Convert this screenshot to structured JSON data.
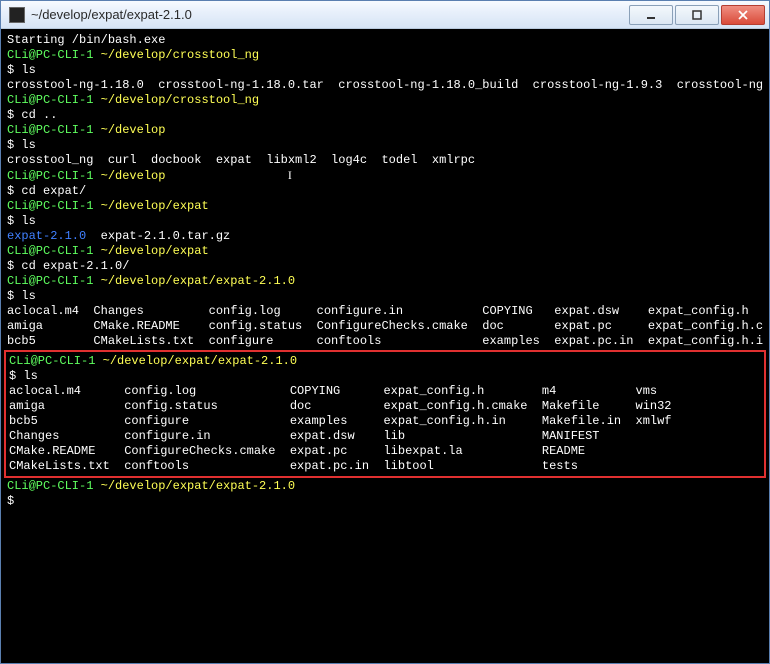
{
  "window": {
    "title": "~/develop/expat/expat-2.1.0"
  },
  "terminal": {
    "start": "Starting /bin/bash.exe",
    "user": "CLi",
    "host": "PC-CLI-1",
    "prompt": "$",
    "blocks": [
      {
        "path": "~/develop/crosstool_ng",
        "cmd": "ls",
        "out": "crosstool-ng-1.18.0  crosstool-ng-1.18.0.tar  crosstool-ng-1.18.0_build  crosstool-ng-1.9.3  crosstool-ng"
      },
      {
        "cmd": "cd .."
      },
      {
        "path": "~/develop",
        "cmd": "ls",
        "out": "crosstool_ng  curl  docbook  expat  libxml2  log4c  todel  xmlrpc"
      },
      {
        "path": "~/develop",
        "cmd": "cd expat/",
        "ibeam": true
      },
      {
        "path": "~/develop/expat",
        "cmd": "ls",
        "out_parts": [
          {
            "t": "expat-2.1.0",
            "c": "blue"
          },
          {
            "t": "  expat-2.1.0.tar.gz",
            "c": "white"
          }
        ]
      },
      {
        "path": "~/develop/expat",
        "cmd": "cd expat-2.1.0/"
      },
      {
        "path": "~/develop/expat/expat-2.1.0",
        "cmd": "ls",
        "out_lines": [
          "aclocal.m4  Changes         config.log     configure.in           COPYING   expat.dsw    expat_config.h",
          "amiga       CMake.README    config.status  ConfigureChecks.cmake  doc       expat.pc     expat_config.h.c",
          "bcb5        CMakeLists.txt  configure      conftools              examples  expat.pc.in  expat_config.h.i"
        ]
      }
    ],
    "boxed": {
      "path": "~/develop/expat/expat-2.1.0",
      "cmd": "ls",
      "out_lines": [
        "aclocal.m4      config.log             COPYING      expat_config.h        m4           vms",
        "amiga           config.status          doc          expat_config.h.cmake  Makefile     win32",
        "bcb5            configure              examples     expat_config.h.in     Makefile.in  xmlwf",
        "Changes         configure.in           expat.dsw    lib                   MANIFEST",
        "CMake.README    ConfigureChecks.cmake  expat.pc     libexpat.la           README",
        "CMakeLists.txt  conftools              expat.pc.in  libtool               tests"
      ]
    },
    "final": {
      "path": "~/develop/expat/expat-2.1.0"
    }
  }
}
